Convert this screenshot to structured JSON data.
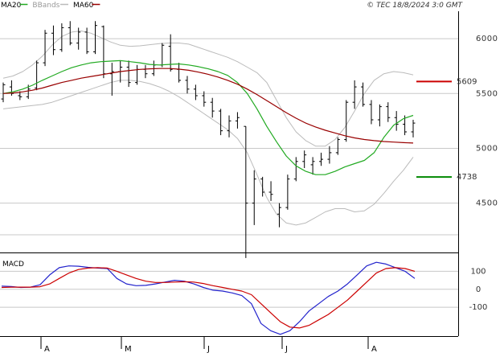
{
  "header": {
    "legend": [
      {
        "label": "MA20",
        "color": "#22aa22"
      },
      {
        "label": "BBands",
        "color": "#bbbbbb"
      },
      {
        "label": "MA60",
        "color": "#990000"
      }
    ],
    "copyright": "© TEC 18/8/2024 3:0 GMT"
  },
  "price_panel": {
    "y_ticks": [
      "6000",
      "5500",
      "5000",
      "4500"
    ],
    "markers": [
      {
        "value": 5609,
        "label": "5609",
        "color": "#cc0000"
      },
      {
        "value": 4738,
        "label": "4738",
        "color": "#008800"
      }
    ]
  },
  "macd_panel": {
    "title": "MACD",
    "y_ticks": [
      "100",
      "0",
      "-100"
    ]
  },
  "x_labels": [
    "A",
    "M",
    "J",
    "J",
    "A"
  ],
  "colors": {
    "candle": "#000000",
    "ma20": "#22aa22",
    "ma60": "#990000",
    "bbands": "#bbbbbb",
    "macd": "#2222cc",
    "signal": "#cc0000",
    "grid": "#c8c8c8"
  },
  "chart_data": [
    {
      "type": "candlestick",
      "title": "",
      "ylim": [
        4050,
        6250
      ],
      "series": [
        {
          "name": "MA20",
          "values": [
            5500,
            5515,
            5540,
            5575,
            5620,
            5660,
            5700,
            5735,
            5760,
            5780,
            5790,
            5795,
            5800,
            5790,
            5780,
            5765,
            5760,
            5765,
            5770,
            5760,
            5745,
            5725,
            5700,
            5665,
            5600,
            5500,
            5360,
            5200,
            5060,
            4930,
            4840,
            4790,
            4760,
            4760,
            4790,
            4830,
            4860,
            4890,
            4960,
            5100,
            5210,
            5270,
            5300
          ]
        },
        {
          "name": "MA60",
          "values": [
            5500,
            5505,
            5515,
            5530,
            5550,
            5575,
            5600,
            5620,
            5640,
            5655,
            5670,
            5685,
            5700,
            5710,
            5720,
            5725,
            5728,
            5728,
            5722,
            5712,
            5695,
            5675,
            5650,
            5620,
            5585,
            5540,
            5490,
            5435,
            5380,
            5325,
            5275,
            5230,
            5195,
            5165,
            5140,
            5115,
            5095,
            5080,
            5070,
            5062,
            5057,
            5052,
            5048
          ]
        },
        {
          "name": "BBands upper",
          "values": [
            5640,
            5660,
            5700,
            5760,
            5840,
            5940,
            6020,
            6060,
            6070,
            6050,
            6010,
            5970,
            5940,
            5930,
            5935,
            5945,
            5955,
            5960,
            5960,
            5950,
            5920,
            5890,
            5860,
            5830,
            5790,
            5740,
            5690,
            5600,
            5440,
            5280,
            5150,
            5070,
            5020,
            5020,
            5080,
            5190,
            5340,
            5500,
            5620,
            5680,
            5700,
            5690,
            5670
          ]
        },
        {
          "name": "BBands lower",
          "values": [
            5360,
            5370,
            5380,
            5390,
            5400,
            5420,
            5450,
            5480,
            5510,
            5540,
            5570,
            5600,
            5620,
            5620,
            5610,
            5590,
            5560,
            5520,
            5470,
            5410,
            5350,
            5290,
            5230,
            5170,
            5090,
            4960,
            4760,
            4550,
            4400,
            4320,
            4300,
            4320,
            4370,
            4420,
            4450,
            4450,
            4420,
            4430,
            4490,
            4590,
            4700,
            4800,
            4920
          ]
        }
      ],
      "candles": [
        [
          5450,
          5600,
          5420,
          5580
        ],
        [
          5560,
          5620,
          5480,
          5500
        ],
        [
          5480,
          5520,
          5440,
          5470
        ],
        [
          5470,
          5580,
          5450,
          5540
        ],
        [
          5550,
          5800,
          5530,
          5780
        ],
        [
          5780,
          6080,
          5750,
          6050
        ],
        [
          6050,
          6120,
          5850,
          5900
        ],
        [
          5900,
          6140,
          5880,
          6100
        ],
        [
          6100,
          6160,
          5940,
          5960
        ],
        [
          5960,
          6100,
          5900,
          6060
        ],
        [
          6060,
          6100,
          5860,
          5880
        ],
        [
          5880,
          6160,
          5860,
          6120
        ],
        [
          6110,
          6120,
          5640,
          5680
        ],
        [
          5680,
          5780,
          5480,
          5700
        ],
        [
          5700,
          5800,
          5600,
          5740
        ],
        [
          5740,
          5800,
          5560,
          5600
        ],
        [
          5600,
          5760,
          5580,
          5720
        ],
        [
          5720,
          5760,
          5640,
          5680
        ],
        [
          5680,
          5800,
          5660,
          5760
        ],
        [
          5760,
          5960,
          5740,
          5940
        ],
        [
          5930,
          6040,
          5700,
          5720
        ],
        [
          5720,
          5780,
          5600,
          5620
        ],
        [
          5620,
          5660,
          5500,
          5540
        ],
        [
          5540,
          5580,
          5440,
          5480
        ],
        [
          5480,
          5520,
          5380,
          5420
        ],
        [
          5420,
          5460,
          5280,
          5340
        ],
        [
          5340,
          5360,
          5120,
          5160
        ],
        [
          5160,
          5300,
          5100,
          5250
        ],
        [
          5250,
          5330,
          5180,
          5280
        ],
        [
          5200,
          5200,
          4000,
          4500
        ],
        [
          4500,
          4800,
          4300,
          4720
        ],
        [
          4720,
          4740,
          4560,
          4600
        ],
        [
          4600,
          4700,
          4520,
          4580
        ],
        [
          4400,
          4500,
          4280,
          4460
        ],
        [
          4460,
          4760,
          4440,
          4720
        ],
        [
          4720,
          4920,
          4700,
          4880
        ],
        [
          4880,
          4980,
          4820,
          4940
        ],
        [
          4850,
          4920,
          4760,
          4880
        ],
        [
          4880,
          4960,
          4840,
          4900
        ],
        [
          4900,
          5020,
          4860,
          4960
        ],
        [
          4960,
          5100,
          4940,
          5080
        ],
        [
          5080,
          5440,
          5060,
          5420
        ],
        [
          5420,
          5620,
          5360,
          5560
        ],
        [
          5560,
          5600,
          5380,
          5400
        ],
        [
          5400,
          5440,
          5220,
          5260
        ],
        [
          5260,
          5400,
          5200,
          5380
        ],
        [
          5380,
          5420,
          5240,
          5280
        ],
        [
          5280,
          5340,
          5160,
          5220
        ],
        [
          5220,
          5300,
          5120,
          5150
        ],
        [
          5150,
          5260,
          5100,
          5230
        ]
      ],
      "markers": [
        5609,
        4738
      ]
    },
    {
      "type": "line",
      "title": "MACD",
      "ylim": [
        -260,
        200
      ],
      "series": [
        {
          "name": "MACD",
          "values": [
            18,
            15,
            10,
            12,
            25,
            80,
            120,
            130,
            128,
            122,
            118,
            115,
            60,
            30,
            20,
            22,
            30,
            40,
            50,
            45,
            30,
            10,
            -5,
            -10,
            -20,
            -35,
            -80,
            -190,
            -230,
            -250,
            -230,
            -180,
            -120,
            -80,
            -40,
            -10,
            30,
            80,
            130,
            150,
            140,
            120,
            100,
            60
          ]
        },
        {
          "name": "Signal",
          "values": [
            10,
            12,
            12,
            12,
            14,
            30,
            60,
            90,
            110,
            118,
            120,
            118,
            100,
            80,
            60,
            45,
            38,
            38,
            40,
            42,
            40,
            32,
            20,
            10,
            0,
            -10,
            -30,
            -80,
            -130,
            -180,
            -210,
            -215,
            -200,
            -170,
            -140,
            -100,
            -60,
            -10,
            40,
            90,
            115,
            120,
            115,
            100
          ]
        }
      ]
    }
  ]
}
